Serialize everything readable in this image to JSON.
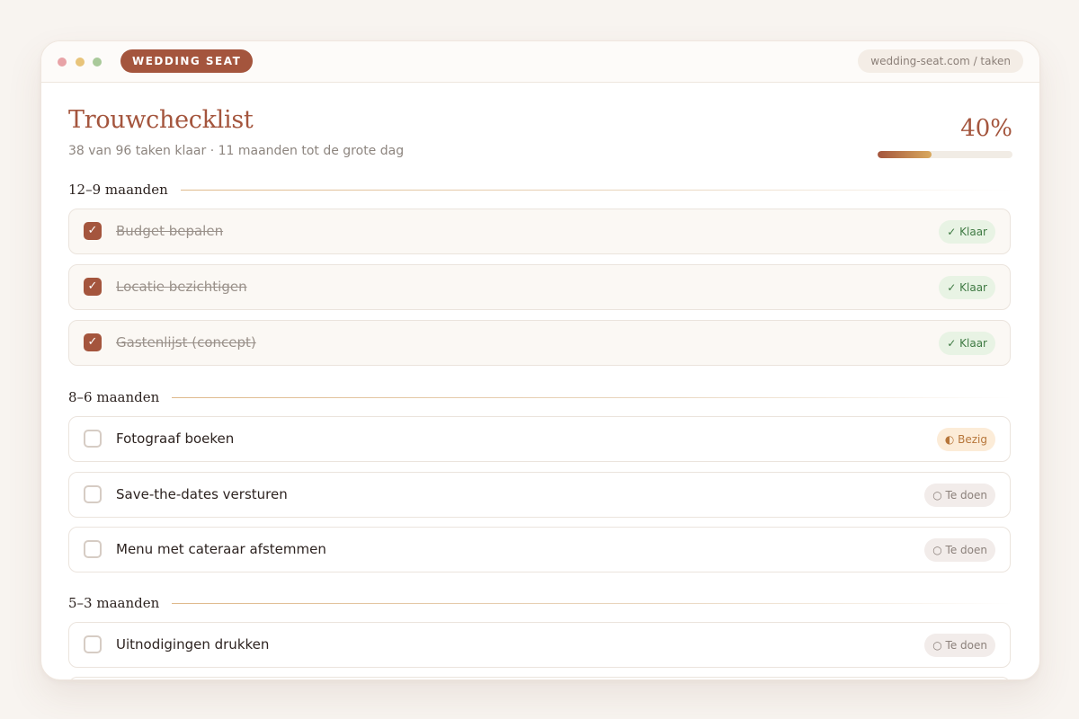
{
  "window": {
    "dots": [
      "#e8a3a7",
      "#e8c47a",
      "#a9c99a"
    ],
    "brand": "WEDDING SEAT",
    "url": "wedding-seat.com / taken"
  },
  "header": {
    "title": "Trouwchecklist",
    "subtitle": "38 van 96 taken klaar · 11 maanden tot de grote dag",
    "progress_label": "40%",
    "progress_fraction": 0.4
  },
  "sections": [
    {
      "title": "12–9 maanden",
      "tasks": [
        {
          "label": "Budget bepalen",
          "checked": true,
          "status": "✓ Klaar",
          "status_kind": "klaar"
        },
        {
          "label": "Locatie bezichtigen",
          "checked": true,
          "status": "✓ Klaar",
          "status_kind": "klaar"
        },
        {
          "label": "Gastenlijst (concept)",
          "checked": true,
          "status": "✓ Klaar",
          "status_kind": "klaar"
        }
      ]
    },
    {
      "title": "8–6 maanden",
      "tasks": [
        {
          "label": "Fotograaf boeken",
          "checked": false,
          "status": "◐ Bezig",
          "status_kind": "bezig"
        },
        {
          "label": "Save-the-dates versturen",
          "checked": false,
          "status": "○ Te doen",
          "status_kind": "todo"
        },
        {
          "label": "Menu met cateraar afstemmen",
          "checked": false,
          "status": "○ Te doen",
          "status_kind": "todo"
        }
      ]
    },
    {
      "title": "5–3 maanden",
      "tasks": [
        {
          "label": "Uitnodigingen drukken",
          "checked": false,
          "status": "○ Te doen",
          "status_kind": "todo"
        }
      ]
    }
  ],
  "checkmark_glyph": "✓",
  "colors": {
    "accent": "#a4553d",
    "done_badge": "#e8f3e4",
    "busy_badge": "#fcecd8",
    "todo_badge": "#f2ecea"
  }
}
